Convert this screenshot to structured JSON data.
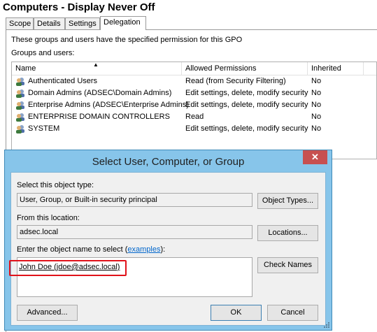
{
  "window": {
    "title": "Computers - Display Never Off"
  },
  "tabs": [
    {
      "label": "Scope"
    },
    {
      "label": "Details"
    },
    {
      "label": "Settings"
    },
    {
      "label": "Delegation"
    }
  ],
  "delegation": {
    "description": "These groups and users have the specified permission for this GPO",
    "groups_label": "Groups and users:",
    "columns": {
      "name": "Name",
      "permissions": "Allowed Permissions",
      "inherited": "Inherited"
    },
    "rows": [
      {
        "name": "Authenticated Users",
        "permissions": "Read (from Security Filtering)",
        "inherited": "No",
        "icon": "users-group-icon"
      },
      {
        "name": "Domain Admins (ADSEC\\Domain Admins)",
        "permissions": "Edit settings, delete, modify security",
        "inherited": "No",
        "icon": "users-group-icon"
      },
      {
        "name": "Enterprise Admins (ADSEC\\Enterprise Admins)",
        "permissions": "Edit settings, delete, modify security",
        "inherited": "No",
        "icon": "users-group-icon"
      },
      {
        "name": "ENTERPRISE DOMAIN CONTROLLERS",
        "permissions": "Read",
        "inherited": "No",
        "icon": "users-group-icon"
      },
      {
        "name": "SYSTEM",
        "permissions": "Edit settings, delete, modify security",
        "inherited": "No",
        "icon": "users-group-icon"
      }
    ]
  },
  "dialog": {
    "title": "Select User, Computer, or Group",
    "close_glyph": "✕",
    "object_type_label": "Select this object type:",
    "object_type_value": "User, Group, or Built-in security principal",
    "object_types_button": "Object Types...",
    "location_label": "From this location:",
    "location_value": "adsec.local",
    "locations_button": "Locations...",
    "enter_label_prefix": "Enter the object name to select (",
    "enter_label_link": "examples",
    "enter_label_suffix": "):",
    "object_name_value": "John Doe (jdoe@adsec.local)",
    "check_names_button": "Check Names",
    "advanced_button": "Advanced...",
    "ok_button": "OK",
    "cancel_button": "Cancel",
    "highlight_color": "#e0121a",
    "titlebar_color": "#87c5ea"
  }
}
